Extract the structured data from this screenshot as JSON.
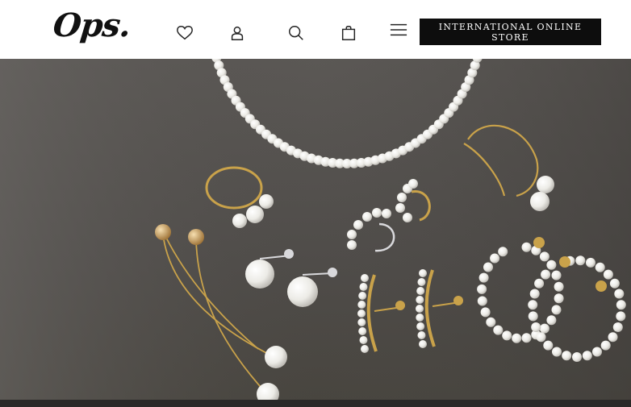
{
  "header": {
    "logo": "Ops.",
    "icons": [
      "heart-icon",
      "user-icon",
      "search-icon",
      "bag-icon",
      "menu-icon"
    ],
    "store_button": "INTERNATIONAL ONLINE STORE"
  },
  "hero": {
    "image": "pearl-jewelry-flatlay",
    "colors": {
      "background": "#55524f",
      "pearl": "#f3f1ec",
      "gold": "#c9a24a",
      "silver": "#d9d9dc"
    }
  }
}
